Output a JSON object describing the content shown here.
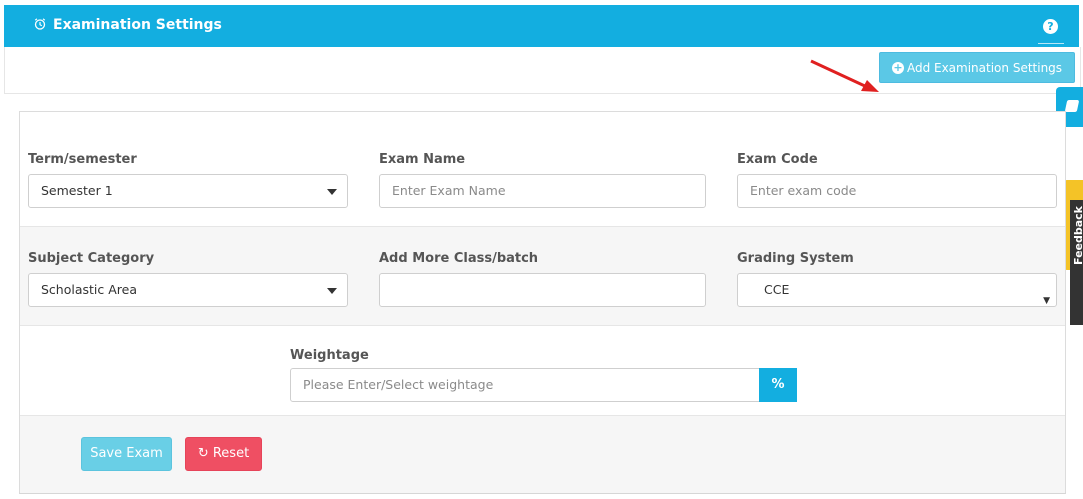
{
  "header": {
    "title": "Examination Settings",
    "help_icon": "question-circle-icon",
    "clock_icon": "alarm-clock-icon",
    "help_text": "?"
  },
  "toolbar": {
    "add_label": "Add Examination Settings",
    "add_icon": "plus-circle-icon",
    "plus_glyph": "+"
  },
  "form": {
    "term": {
      "label": "Term/semester",
      "value": "Semester 1"
    },
    "exam_name": {
      "label": "Exam Name",
      "placeholder": "Enter Exam Name"
    },
    "exam_code": {
      "label": "Exam Code",
      "placeholder": "Enter exam code"
    },
    "subject_category": {
      "label": "Subject Category",
      "value": "Scholastic Area"
    },
    "add_more": {
      "label": "Add More Class/batch",
      "value": ""
    },
    "grading": {
      "label": "Grading System",
      "value": "CCE"
    },
    "weightage": {
      "label": "Weightage",
      "placeholder": "Please Enter/Select weightage",
      "addon": "%"
    }
  },
  "actions": {
    "save_label": "Save Exam",
    "reset_label": "Reset",
    "reset_icon": "refresh-icon",
    "reset_glyph": "↻"
  },
  "side": {
    "book_icon": "book-icon",
    "feedback_label": "Feedback"
  },
  "colors": {
    "primary": "#13aee0",
    "danger": "#ef4f63",
    "feedback": "#f4c327"
  }
}
